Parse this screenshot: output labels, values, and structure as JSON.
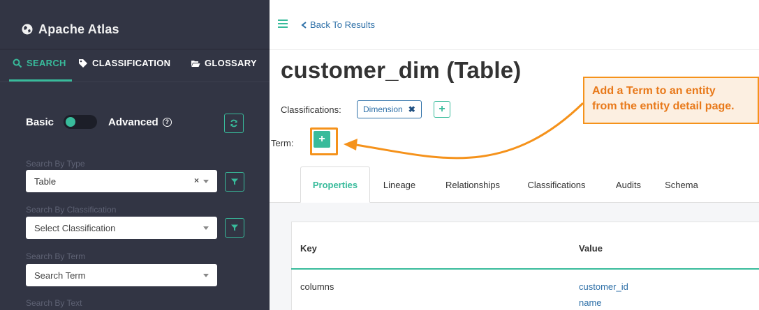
{
  "sidebar": {
    "brand": "Apache Atlas",
    "tabs": {
      "search": "SEARCH",
      "classification": "CLASSIFICATION",
      "glossary": "GLOSSARY"
    },
    "basic_label": "Basic",
    "advanced_label": "Advanced",
    "help_symbol": "?",
    "search_by_type": {
      "label": "Search By Type",
      "value": "Table",
      "clear": "×"
    },
    "search_by_classification": {
      "label": "Search By Classification",
      "placeholder": "Select Classification"
    },
    "search_by_term": {
      "label": "Search By Term",
      "placeholder": "Search Term"
    },
    "search_by_text": {
      "label": "Search By Text"
    }
  },
  "header": {
    "back_label": "Back To Results"
  },
  "entity": {
    "title": "customer_dim (Table)",
    "classifications_label": "Classifications:",
    "classification_chip": "Dimension",
    "chip_remove": "✖",
    "add_symbol": "+",
    "term_label": "Term:"
  },
  "callout": {
    "line1": "Add a Term to an entity",
    "line2": "from the entity detail page."
  },
  "detail_tabs": [
    "Properties",
    "Lineage",
    "Relationships",
    "Classifications",
    "Audits",
    "Schema"
  ],
  "properties_table": {
    "headers": {
      "key": "Key",
      "value": "Value"
    },
    "rows": [
      {
        "key": "columns",
        "values": [
          "customer_id",
          "name"
        ]
      }
    ]
  },
  "colors": {
    "accent": "#38bb9b",
    "sidebar_bg": "#323544",
    "link": "#2d6fa7",
    "callout": "#f5921b"
  }
}
